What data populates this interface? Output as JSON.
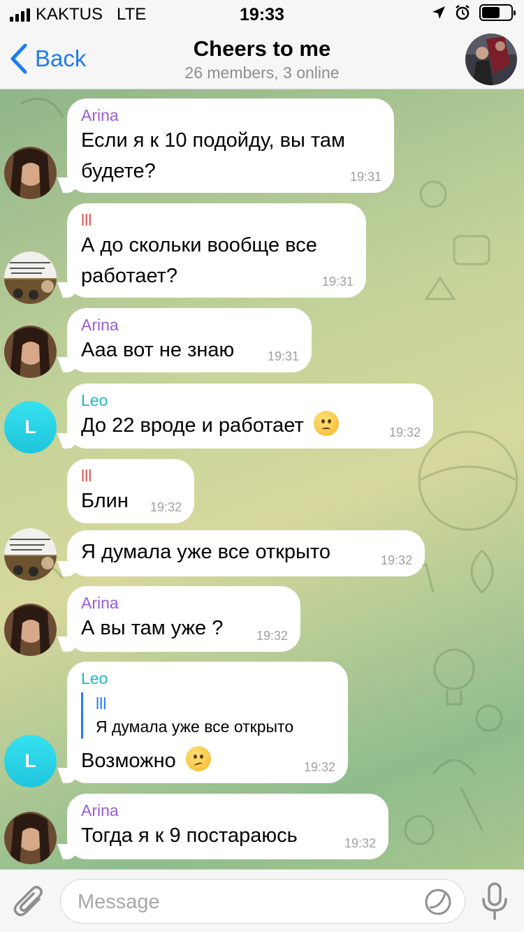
{
  "status_bar": {
    "carrier": "KAKTUS",
    "network": "LTE",
    "time": "19:33"
  },
  "header": {
    "back_label": "Back",
    "title": "Cheers to me",
    "subtitle": "26 members, 3 online"
  },
  "messages": [
    {
      "sender": "Arina",
      "sender_color": "#9a5ad6",
      "text_lines": [
        "Если я к 10 подойду, вы там",
        "будете?"
      ],
      "time": "19:31"
    },
    {
      "sender": "lll",
      "sender_color": "#e0544b",
      "text_lines": [
        "А до скольки вообще все",
        "работает?"
      ],
      "time": "19:31"
    },
    {
      "sender": "Arina",
      "sender_color": "#9a5ad6",
      "text_lines": [
        "Ааа вот не знаю"
      ],
      "time": "19:31"
    },
    {
      "sender": "Leo",
      "sender_color": "#1fb8c9",
      "avatar_letter": "L",
      "text_lines": [
        "До 22 вроде и работает"
      ],
      "emoji": "worried-face",
      "time": "19:32"
    },
    {
      "sender": "lll",
      "sender_color": "#e0544b",
      "text_lines": [
        "Блин"
      ],
      "time": "19:32"
    },
    {
      "text_lines": [
        "Я думала уже все открыто"
      ],
      "time": "19:32"
    },
    {
      "sender": "Arina",
      "sender_color": "#9a5ad6",
      "text_lines": [
        "А вы там уже ?"
      ],
      "time": "19:32"
    },
    {
      "sender": "Leo",
      "sender_color": "#1fb8c9",
      "avatar_letter": "L",
      "reply_to": {
        "name": "lll",
        "text": "Я думала уже все открыто"
      },
      "text_lines": [
        "Возможно"
      ],
      "emoji": "woozy-face",
      "time": "19:32"
    },
    {
      "sender": "Arina",
      "sender_color": "#9a5ad6",
      "text_lines": [
        "Тогда я к 9 постараюсь"
      ],
      "time": "19:32"
    }
  ],
  "input": {
    "placeholder": "Message"
  },
  "icons": [
    "back-chevron-icon",
    "attachment-icon",
    "sticker-icon",
    "microphone-icon",
    "location-arrow-icon",
    "alarm-icon",
    "battery-icon",
    "signal-icon"
  ]
}
